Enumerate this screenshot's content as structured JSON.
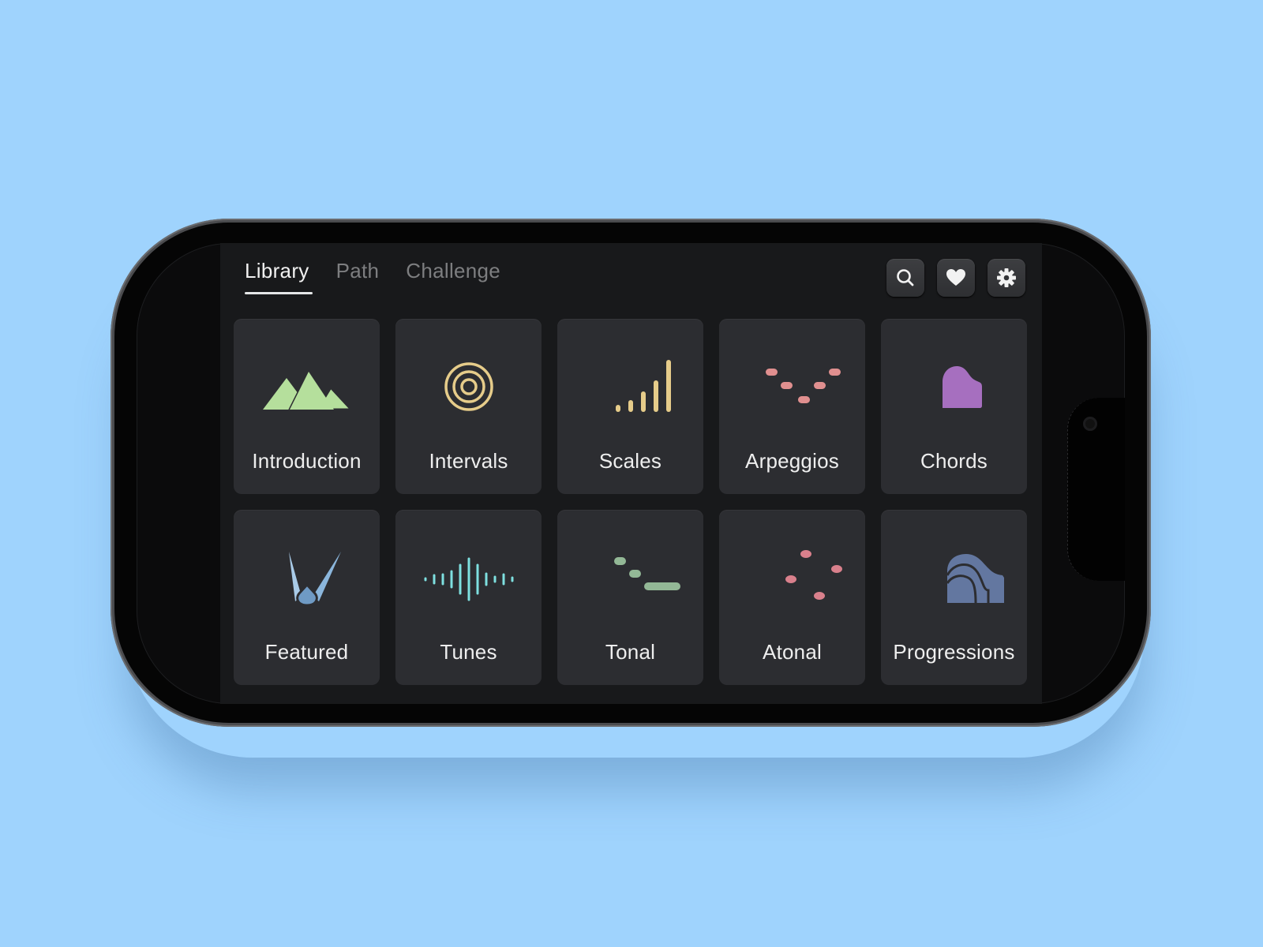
{
  "app": {
    "tabs": [
      {
        "label": "Library",
        "active": true
      },
      {
        "label": "Path",
        "active": false
      },
      {
        "label": "Challenge",
        "active": false
      }
    ],
    "toolbar": [
      {
        "name": "search",
        "icon": "search-icon"
      },
      {
        "name": "favorites",
        "icon": "heart-icon"
      },
      {
        "name": "settings",
        "icon": "gear-icon"
      }
    ],
    "categories": [
      {
        "label": "Introduction",
        "icon": "mountains-icon",
        "color": "#b5df9c"
      },
      {
        "label": "Intervals",
        "icon": "concentric-circles-icon",
        "color": "#e6cc8a"
      },
      {
        "label": "Scales",
        "icon": "ascending-bars-icon",
        "color": "#e6cc8a"
      },
      {
        "label": "Arpeggios",
        "icon": "v-dots-icon",
        "color": "#e08f8f"
      },
      {
        "label": "Chords",
        "icon": "grand-piano-icon",
        "color": "#a66fbf"
      },
      {
        "label": "Featured",
        "icon": "spotlights-icon",
        "color": "#8bb6dc"
      },
      {
        "label": "Tunes",
        "icon": "waveform-icon",
        "color": "#7ee0e0"
      },
      {
        "label": "Tonal",
        "icon": "descending-notes-icon",
        "color": "#93b896"
      },
      {
        "label": "Atonal",
        "icon": "scattered-dots-icon",
        "color": "#d9808c"
      },
      {
        "label": "Progressions",
        "icon": "layered-hills-icon",
        "color": "#6377a0"
      }
    ]
  }
}
